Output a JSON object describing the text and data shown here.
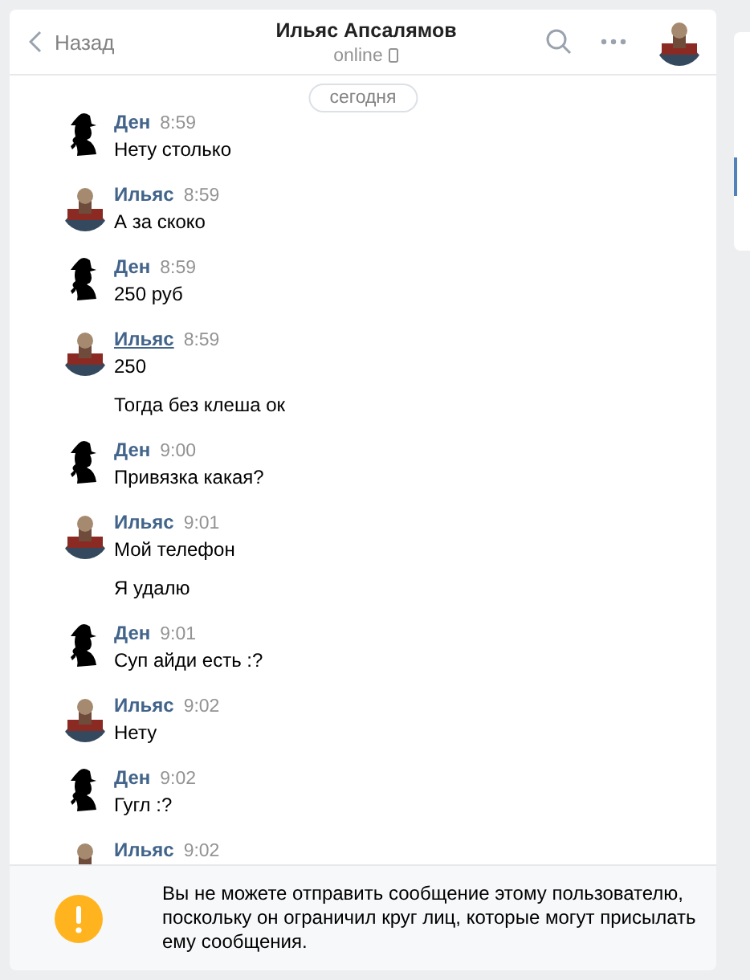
{
  "header": {
    "back": "Назад",
    "title": "Ильяс Апсалямов",
    "status": "online"
  },
  "date_badge": "сегодня",
  "messages": [
    {
      "author": "Ден",
      "kind": "silhouette",
      "time": "8:59",
      "underlined": false,
      "texts": [
        "Нету столько"
      ]
    },
    {
      "author": "Ильяс",
      "kind": "picture",
      "time": "8:59",
      "underlined": false,
      "texts": [
        "А за скоко"
      ]
    },
    {
      "author": "Ден",
      "kind": "silhouette",
      "time": "8:59",
      "underlined": false,
      "texts": [
        "250 руб"
      ]
    },
    {
      "author": "Ильяс",
      "kind": "picture",
      "time": "8:59",
      "underlined": true,
      "texts": [
        "250",
        "Тогда без клеша ок"
      ]
    },
    {
      "author": "Ден",
      "kind": "silhouette",
      "time": "9:00",
      "underlined": false,
      "texts": [
        "Привязка какая?"
      ]
    },
    {
      "author": "Ильяс",
      "kind": "picture",
      "time": "9:01",
      "underlined": false,
      "texts": [
        "Мой телефон",
        "Я удалю"
      ]
    },
    {
      "author": "Ден",
      "kind": "silhouette",
      "time": "9:01",
      "underlined": false,
      "texts": [
        "Суп айди есть :?"
      ]
    },
    {
      "author": "Ильяс",
      "kind": "picture",
      "time": "9:02",
      "underlined": false,
      "texts": [
        "Нету"
      ]
    },
    {
      "author": "Ден",
      "kind": "silhouette",
      "time": "9:02",
      "underlined": false,
      "texts": [
        "Гугл :?"
      ]
    },
    {
      "author": "Ильяс",
      "kind": "picture",
      "time": "9:02",
      "underlined": false
    }
  ],
  "notice": {
    "text": "Вы не можете отправить сообщение этому пользователю, поскольку он ограничил круг лиц, которые могут присылать ему сообщения."
  }
}
